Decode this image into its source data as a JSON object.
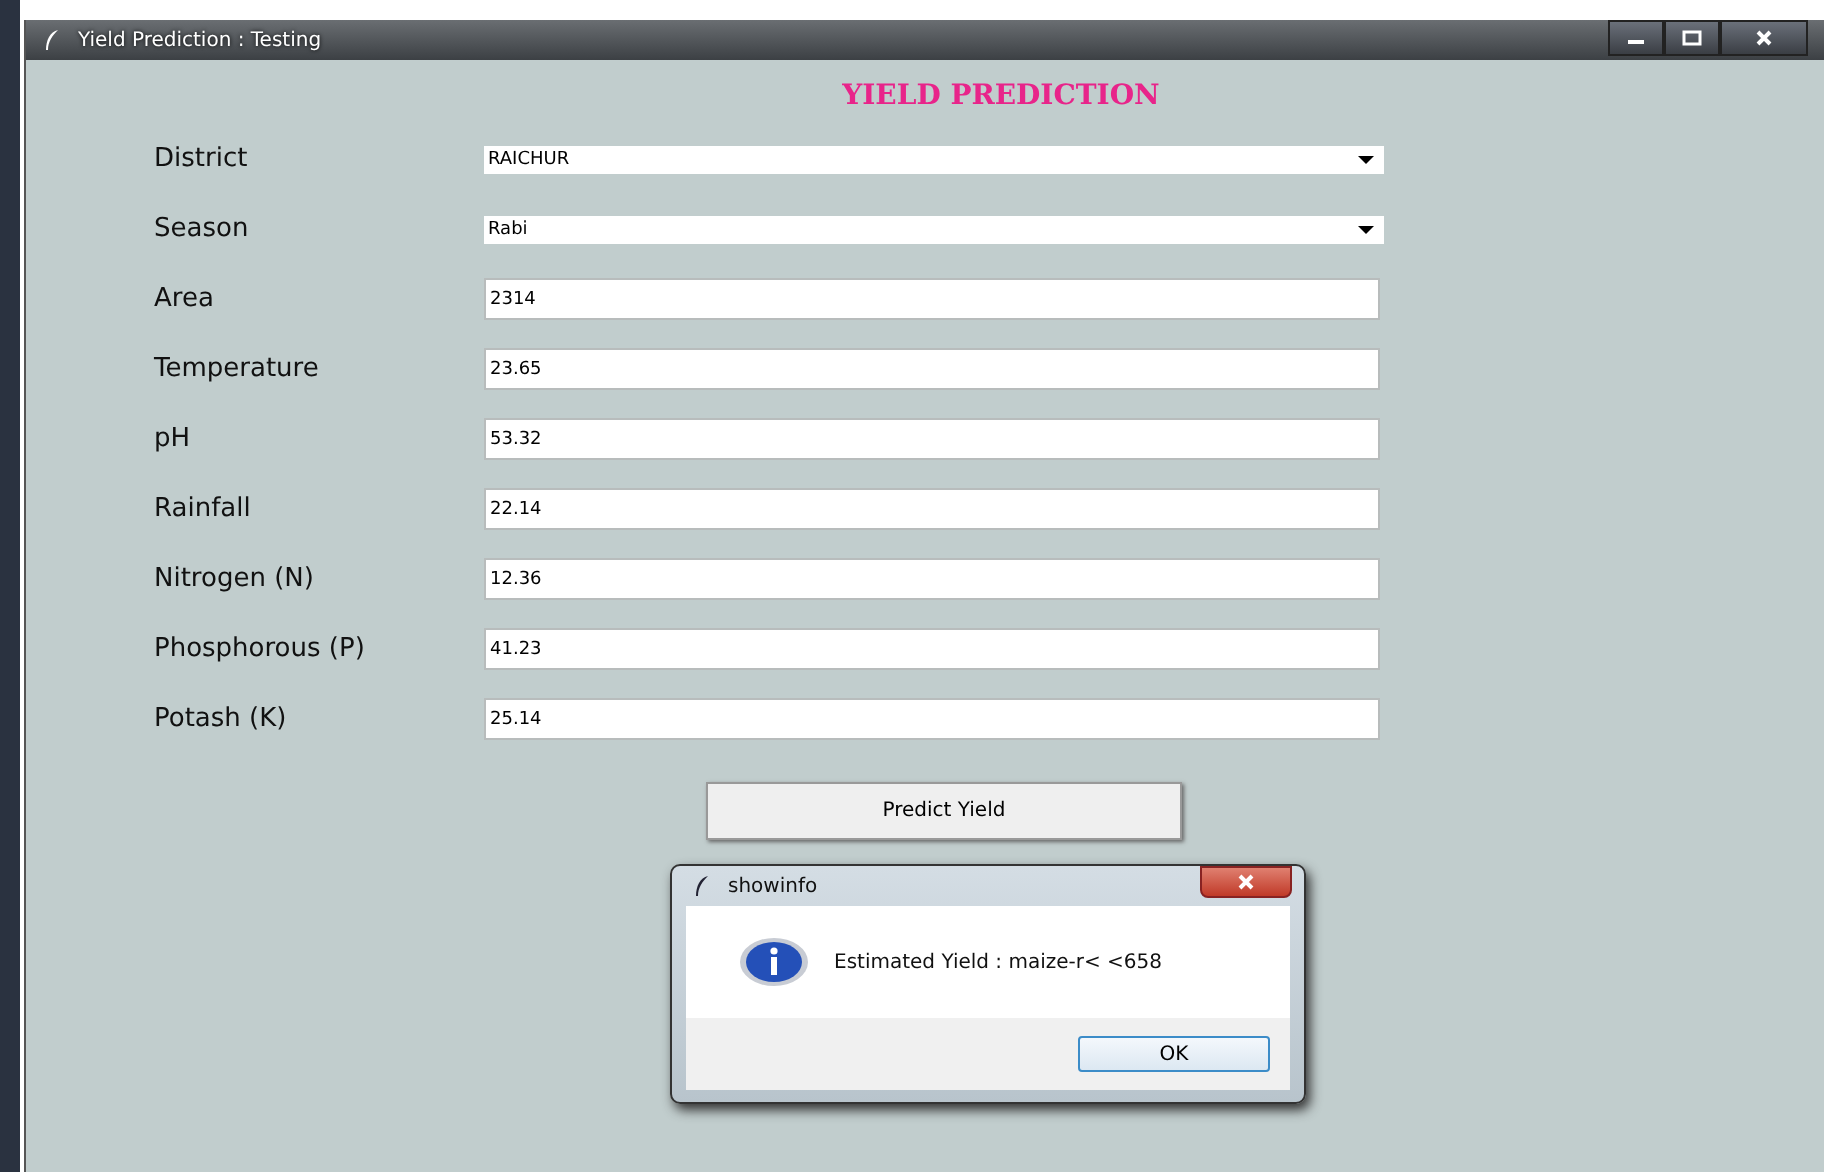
{
  "window": {
    "title": "Yield Prediction : Testing"
  },
  "heading": "YIELD PREDICTION",
  "fields": [
    {
      "label": "District",
      "kind": "combo",
      "value": "RAICHUR"
    },
    {
      "label": "Season",
      "kind": "combo",
      "value": "Rabi"
    },
    {
      "label": "Area",
      "kind": "entry",
      "value": "2314"
    },
    {
      "label": "Temperature",
      "kind": "entry",
      "value": "23.65"
    },
    {
      "label": "pH",
      "kind": "entry",
      "value": "53.32"
    },
    {
      "label": "Rainfall",
      "kind": "entry",
      "value": "22.14"
    },
    {
      "label": "Nitrogen (N)",
      "kind": "entry",
      "value": "12.36"
    },
    {
      "label": "Phosphorous (P)",
      "kind": "entry",
      "value": "41.23"
    },
    {
      "label": "Potash (K)",
      "kind": "entry",
      "value": "25.14"
    }
  ],
  "button": "Predict Yield",
  "dialog": {
    "title": "showinfo",
    "message": "Estimated Yield : maize-r< <658",
    "button": "OK"
  }
}
